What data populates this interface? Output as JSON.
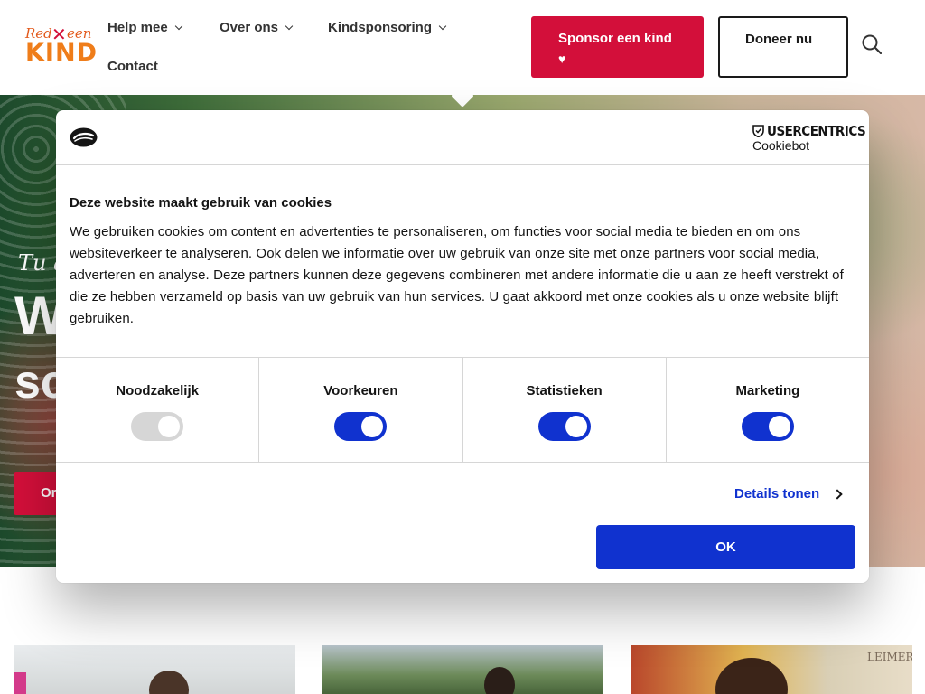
{
  "logo": {
    "line1a": "Red",
    "mark": "✕",
    "line1b": "een",
    "line2": "KIND"
  },
  "nav": {
    "items": [
      {
        "label": "Help mee"
      },
      {
        "label": "Over ons"
      },
      {
        "label": "Kindsponsoring"
      },
      {
        "label": "Contact"
      }
    ],
    "sponsor_label": "Sponsor een kind",
    "sponsor_icon": "heart-icon",
    "donate_label": "Doneer nu",
    "search_icon": "search-icon"
  },
  "hero": {
    "subtitle": "Tu a",
    "title_line1": "W",
    "title_line2": "sc",
    "button_label": "Or"
  },
  "cards": [
    {
      "label": ""
    },
    {
      "label": ""
    },
    {
      "label": "LEIMERA"
    }
  ],
  "cookie_dialog": {
    "brand_line1": "USERCENTRICS",
    "brand_line2": "Cookiebot",
    "heading": "Deze website maakt gebruik van cookies",
    "body": "We gebruiken cookies om content en advertenties te personaliseren, om functies voor social media te bieden en om ons websiteverkeer te analyseren. Ook delen we informatie over uw gebruik van onze site met onze partners voor social media, adverteren en analyse. Deze partners kunnen deze gegevens combineren met andere informatie die u aan ze heeft verstrekt of die ze hebben verzameld op basis van uw gebruik van hun services. U gaat akkoord met onze cookies als u onze website blijft gebruiken.",
    "categories": [
      {
        "label": "Noodzakelijk",
        "enabled": true,
        "disabled": true
      },
      {
        "label": "Voorkeuren",
        "enabled": true
      },
      {
        "label": "Statistieken",
        "enabled": true
      },
      {
        "label": "Marketing",
        "enabled": true
      }
    ],
    "details_label": "Details tonen",
    "ok_label": "OK"
  },
  "colors": {
    "brand_red": "#d30f3a",
    "brand_orange": "#ef7d1a",
    "cookiebot_blue": "#1032cf",
    "toggle_disabled": "#d6d6d6"
  }
}
